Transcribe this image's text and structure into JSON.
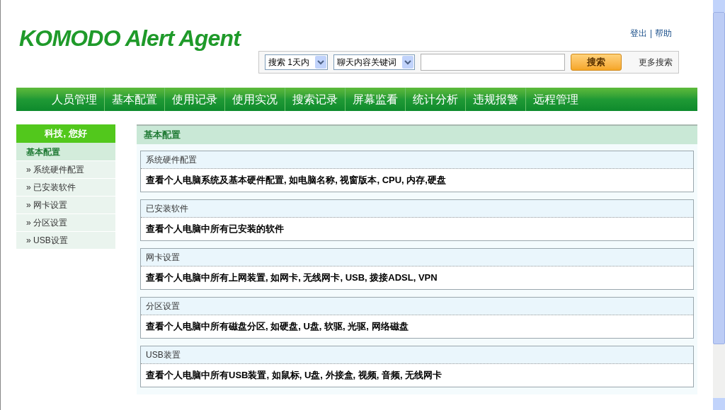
{
  "logo": "KOMODO Alert Agent",
  "top_links": [
    {
      "label": "登出"
    },
    {
      "label": "帮助"
    }
  ],
  "separator": "|",
  "search": {
    "range_select": "搜索 1天内",
    "type_select": "聊天内容关键词",
    "button": "搜索",
    "more": "更多搜索"
  },
  "nav": [
    {
      "label": "人员管理"
    },
    {
      "label": "基本配置"
    },
    {
      "label": "使用记录"
    },
    {
      "label": "使用实况"
    },
    {
      "label": "搜索记录"
    },
    {
      "label": "屏幕监看"
    },
    {
      "label": "统计分析"
    },
    {
      "label": "违规报警"
    },
    {
      "label": "远程管理"
    }
  ],
  "sidebar": {
    "greeting": "科技, 您好",
    "section": "基本配置",
    "items": [
      {
        "label": "系统硬件配置"
      },
      {
        "label": "已安装软件"
      },
      {
        "label": "网卡设置"
      },
      {
        "label": "分区设置"
      },
      {
        "label": "USB设置"
      }
    ],
    "bullet": "»"
  },
  "main": {
    "title": "基本配置",
    "cards": [
      {
        "title": "系统硬件配置",
        "text": "查看个人电脑系统及基本硬件配置, 如电脑名称, 视窗版本, CPU, 内存,硬盘"
      },
      {
        "title": "已安装软件",
        "text": "查看个人电脑中所有已安装的软件"
      },
      {
        "title": "网卡设置",
        "text": "查看个人电脑中所有上网装置, 如网卡, 无线网卡, USB, 拨接ADSL, VPN"
      },
      {
        "title": "分区设置",
        "text": "查看个人电脑中所有磁盘分区, 如硬盘, U盘, 软驱, 光驱, 网络磁盘"
      },
      {
        "title": "USB装置",
        "text": "查看个人电脑中所有USB装置, 如鼠标, U盘, 外接盒, 视频, 音频, 无线网卡"
      }
    ]
  }
}
